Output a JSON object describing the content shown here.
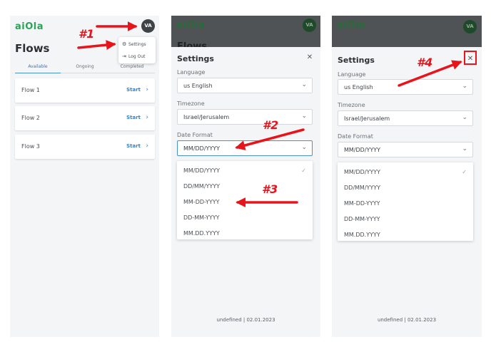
{
  "app": {
    "logo_text": "aiOla",
    "avatar_initials": "VA"
  },
  "flows_screen": {
    "title": "Flows",
    "tabs": [
      {
        "label": "Available",
        "active": true
      },
      {
        "label": "Ongoing",
        "active": false
      },
      {
        "label": "Completed",
        "active": false
      }
    ],
    "flows": [
      {
        "name": "Flow 1",
        "action": "Start"
      },
      {
        "name": "Flow 2",
        "action": "Start"
      },
      {
        "name": "Flow 3",
        "action": "Start"
      }
    ],
    "user_menu": {
      "settings_label": "Settings",
      "logout_label": "Log Out"
    }
  },
  "settings": {
    "title": "Settings",
    "flows_peek_title": "Flows",
    "language": {
      "label": "Language",
      "value": "us English"
    },
    "timezone": {
      "label": "Timezone",
      "value": "Israel/Jerusalem"
    },
    "date_format": {
      "label": "Date Format",
      "value": "MM/DD/YYYY",
      "options": [
        "MM/DD/YYYY",
        "DD/MM/YYYY",
        "MM-DD-YYYY",
        "DD-MM-YYYY",
        "MM.DD.YYYY"
      ],
      "selected_index": 0
    },
    "footer": "undefined | 02.01.2023"
  },
  "annotations": [
    "#1",
    "#2",
    "#3",
    "#4"
  ],
  "colors": {
    "annotation": "#e8141b",
    "brand_green": "#2ea15a",
    "link_blue": "#3b82c4"
  }
}
